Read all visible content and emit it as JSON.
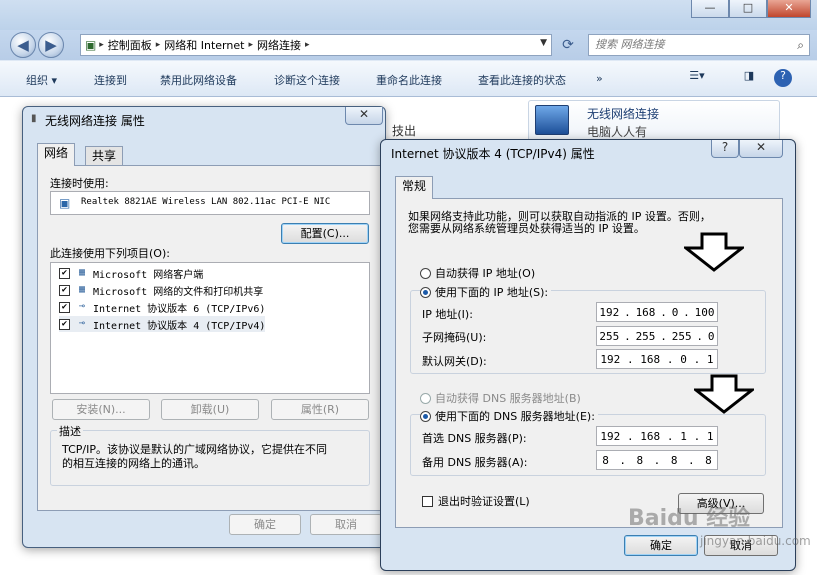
{
  "explorer": {
    "breadcrumb": [
      "控制面板",
      "网络和 Internet",
      "网络连接"
    ],
    "search_placeholder": "搜索 网络连接",
    "toolbar": [
      "组织 ▾",
      "连接到",
      "禁用此网络设备",
      "诊断这个连接",
      "重命名此连接",
      "查看此连接的状态",
      "»"
    ],
    "adapter": {
      "name": "无线网络连接",
      "status": "电脑人人有"
    },
    "bg_text": "技出",
    "window_buttons": [
      "—",
      "□",
      "✕"
    ]
  },
  "props_dialog": {
    "title": "无线网络连接 属性",
    "tabs": [
      "网络",
      "共享"
    ],
    "connect_using_label": "连接时使用:",
    "adapter_name": "Realtek 8821AE Wireless LAN 802.11ac PCI-E NIC",
    "configure_button": "配置(C)...",
    "items_label": "此连接使用下列项目(O):",
    "items": [
      {
        "label": "Microsoft 网络客户端",
        "checked": true,
        "icon": "network-client-icon"
      },
      {
        "label": "Microsoft 网络的文件和打印机共享",
        "checked": true,
        "icon": "file-share-icon"
      },
      {
        "label": "Internet 协议版本 6 (TCP/IPv6)",
        "checked": true,
        "icon": "protocol-icon"
      },
      {
        "label": "Internet 协议版本 4 (TCP/IPv4)",
        "checked": true,
        "icon": "protocol-icon"
      }
    ],
    "install_button": "安装(N)...",
    "uninstall_button": "卸载(U)",
    "properties_button": "属性(R)",
    "description_title": "描述",
    "description_text_1": "TCP/IP。该协议是默认的广域网络协议，它提供在不同",
    "description_text_2": "的相互连接的网络上的通讯。",
    "ok_button": "确定",
    "cancel_button": "取消"
  },
  "ipv4_dialog": {
    "title": "Internet 协议版本 4 (TCP/IPv4) 属性",
    "tab": "常规",
    "intro_1": "如果网络支持此功能，则可以获取自动指派的 IP 设置。否则，",
    "intro_2": "您需要从网络系统管理员处获得适当的 IP 设置。",
    "auto_ip": "自动获得 IP 地址(O)",
    "manual_ip": "使用下面的 IP 地址(S):",
    "ip_label": "IP 地址(I):",
    "ip": [
      "192",
      "168",
      "0",
      "100"
    ],
    "mask_label": "子网掩码(U):",
    "mask": [
      "255",
      "255",
      "255",
      "0"
    ],
    "gateway_label": "默认网关(D):",
    "gateway": [
      "192",
      "168",
      "0",
      "1"
    ],
    "auto_dns": "自动获得 DNS 服务器地址(B)",
    "manual_dns": "使用下面的 DNS 服务器地址(E):",
    "dns1_label": "首选 DNS 服务器(P):",
    "dns1": [
      "192",
      "168",
      "1",
      "1"
    ],
    "dns2_label": "备用 DNS 服务器(A):",
    "dns2": [
      "8",
      "8",
      "8",
      "8"
    ],
    "validate_label": "退出时验证设置(L)",
    "advanced_button": "高级(V)...",
    "ok_button": "确定",
    "cancel_button": "取消",
    "help_button": "?",
    "close_button": "✕"
  },
  "watermark": {
    "main": "Baidu 经验",
    "sub": "jingyan.baidu.com"
  }
}
